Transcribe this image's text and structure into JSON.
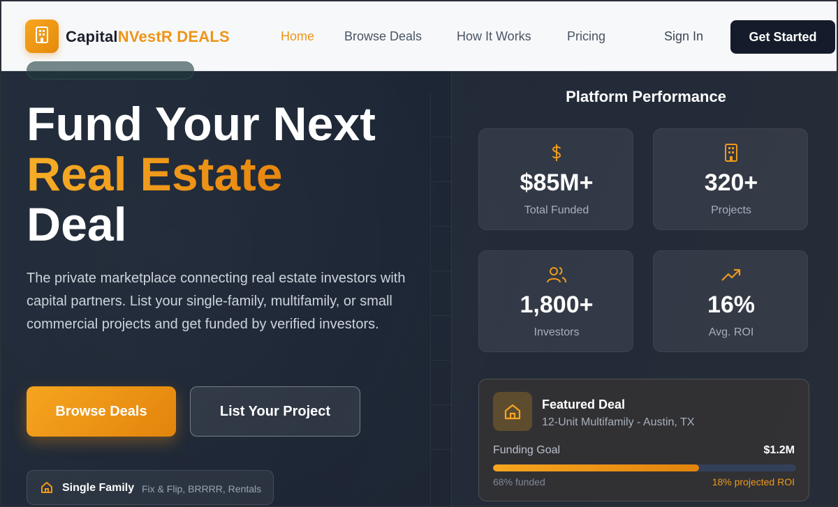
{
  "nav": {
    "brand_part1": "Capital",
    "brand_part2": "NVestR DEALS",
    "links": [
      {
        "label": "Home"
      },
      {
        "label": "Browse Deals"
      },
      {
        "label": "How It Works"
      },
      {
        "label": "Pricing"
      }
    ],
    "signin_label": "Sign In",
    "cta_label": "Get Started"
  },
  "hero": {
    "headline_line1": "Fund Your Next",
    "headline_line2": "Real Estate",
    "headline_line3": "Deal",
    "subheadline": "The private marketplace connecting real estate investors with capital partners. List your single-family, multifamily, or small commercial projects and get funded by verified investors.",
    "primary_button": "Browse Deals",
    "secondary_button": "List Your Project",
    "tag_title": "Single Family",
    "tag_desc": "Fix & Flip, BRRRR, Rentals"
  },
  "panel": {
    "title": "Platform Performance",
    "stats": [
      {
        "icon": "dollar-icon",
        "value": "$85M+",
        "label": "Total Funded"
      },
      {
        "icon": "building-icon",
        "value": "320+",
        "label": "Projects"
      },
      {
        "icon": "users-icon",
        "value": "1,800+",
        "label": "Investors"
      },
      {
        "icon": "trending-up-icon",
        "value": "16%",
        "label": "Avg. ROI"
      }
    ],
    "featured": {
      "icon": "home-icon",
      "title": "Featured Deal",
      "subtitle": "12-Unit Multifamily - Austin, TX",
      "goal_label": "Funding Goal",
      "goal_amount": "$1.2M",
      "funded_fraction": 0.68,
      "funded_text": "68% funded",
      "roi_text": "18% projected ROI"
    }
  },
  "colors": {
    "accent": "#ef9416",
    "navy": "#141c2b",
    "hero_bg": "#1f2937"
  }
}
